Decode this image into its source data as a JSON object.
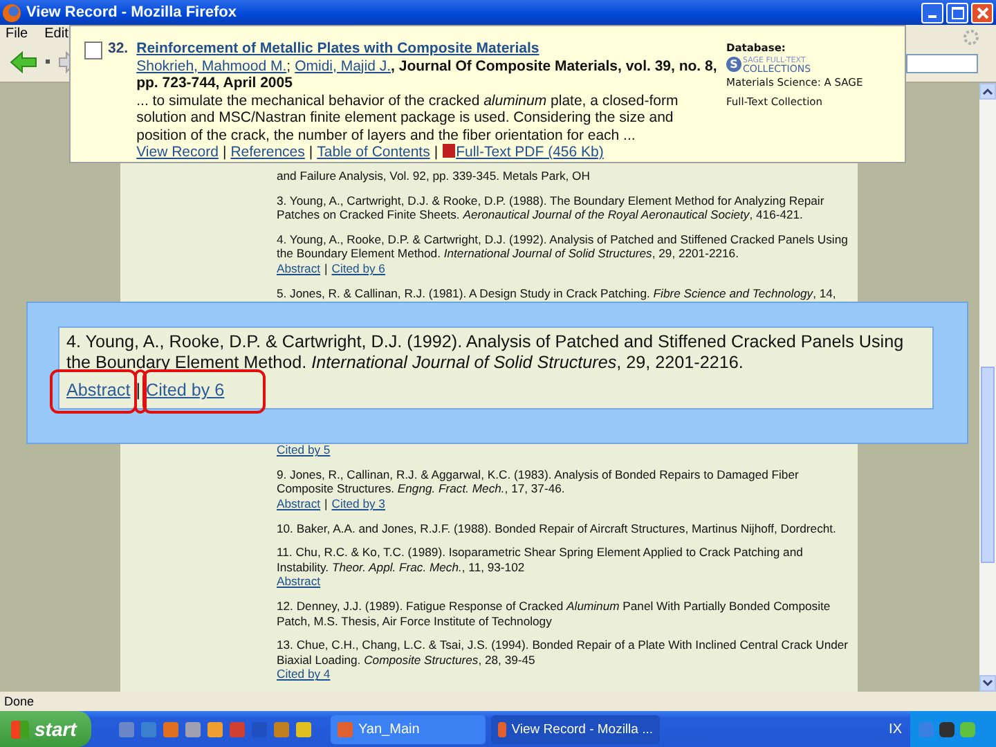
{
  "window": {
    "title": "View Record - Mozilla Firefox"
  },
  "menu": [
    "File",
    "Edit"
  ],
  "link_separator": "|",
  "references": [
    {
      "kind": "text",
      "text": "and Failure Analysis, Vol. 92, pp. 339-345. Metals Park, OH"
    },
    {
      "kind": "entry",
      "text": "3. Young, A., Cartwright, D.J. & Rooke, D.P. (1988). The Boundary Element Method for Analyzing Repair Patches on Cracked Finite Sheets. *Aeronautical Journal of the Royal Aeronautical Society*, 416-421."
    },
    {
      "kind": "entry",
      "text": "4. Young, A., Rooke, D.P. & Cartwright, D.J. (1992). Analysis of Patched and Stiffened Cracked Panels Using the Boundary Element Method. *International Journal of Solid Structures*, 29, 2201-2216.",
      "links": [
        "Abstract",
        "Cited by 6"
      ]
    },
    {
      "kind": "entry",
      "text": "5. Jones, R. & Callinan, R.J. (1981). A Design Study in Crack Patching. *Fibre Science and Technology*, 14,"
    },
    {
      "kind": "links",
      "links": [
        "Cited by 5"
      ]
    },
    {
      "kind": "entry",
      "text": "9. Jones, R., Callinan, R.J. & Aggarwal, K.C. (1983). Analysis of Bonded Repairs to Damaged Fiber Composite Structures. *Engng. Fract. Mech.*, 17, 37-46.",
      "links": [
        "Abstract",
        "Cited by 3"
      ]
    },
    {
      "kind": "entry",
      "text": "10. Baker, A.A. and Jones, R.J.F. (1988). Bonded Repair of Aircraft Structures, Martinus Nijhoff, Dordrecht."
    },
    {
      "kind": "entry",
      "text": "11. Chu, R.C. & Ko, T.C. (1989). Isoparametric Shear Spring Element Applied to Crack Patching and Instability. *Theor. Appl. Frac. Mech.*, 11, 93-102",
      "links": [
        "Abstract"
      ]
    },
    {
      "kind": "entry",
      "text": "12. Denney, J.J. (1989). Fatigue Response of Cracked *Aluminum* Panel With Partially Bonded Composite Patch, M.S. Thesis, Air Force Institute of Technology"
    },
    {
      "kind": "entry",
      "text": "13. Chue, C.H., Chang, L.C. & Tsai, J.S. (1994). Bonded Repair of a Plate With Inclined Central Crack Under Biaxial Loading. *Composite Structures*, 28, 39-45",
      "links": [
        "Cited by 4"
      ]
    }
  ],
  "popup": {
    "number": "32.",
    "checked": false,
    "title": "Reinforcement of Metallic Plates with Composite Materials",
    "authors": [
      "Shokrieh, Mahmood M.",
      "Omidi, Majid J."
    ],
    "author_separator": ";",
    "source_prefix": ",",
    "source": "Journal Of Composite Materials, vol. 39, no. 8, pp. 723-744, April 2005",
    "snippet": "... to simulate the mechanical behavior of the cracked *aluminum* plate, a closed-form solution and MSC/Nastran finite element package is used. Considering the size and position of the crack, the number of layers and the fiber orientation for each ...",
    "links": [
      "View Record",
      "References",
      "Table of Contents",
      "Full-Text PDF (456 Kb)"
    ],
    "database_label": "Database:",
    "logo_mark": "S",
    "logo": [
      "SAGE FULL-TEXT",
      "COLLECTIONS"
    ],
    "collection": [
      "Materials Science: A SAGE",
      "Full-Text Collection"
    ]
  },
  "zoom_box": {
    "text": "4. Young, A., Rooke, D.P. & Cartwright, D.J. (1992). Analysis of Patched and Stiffened Cracked Panels Using the Boundary Element Method. *International Journal of Solid Structures*, 29, 2201-2216.",
    "links": [
      "Abstract",
      "Cited by 6"
    ]
  },
  "status_bar": "Done",
  "taskbar": {
    "start": "start",
    "tasks": [
      {
        "label": "Yan_Main",
        "selected": false
      },
      {
        "label": "View Record - Mozilla ...",
        "selected": true
      }
    ],
    "tray": "IX"
  }
}
